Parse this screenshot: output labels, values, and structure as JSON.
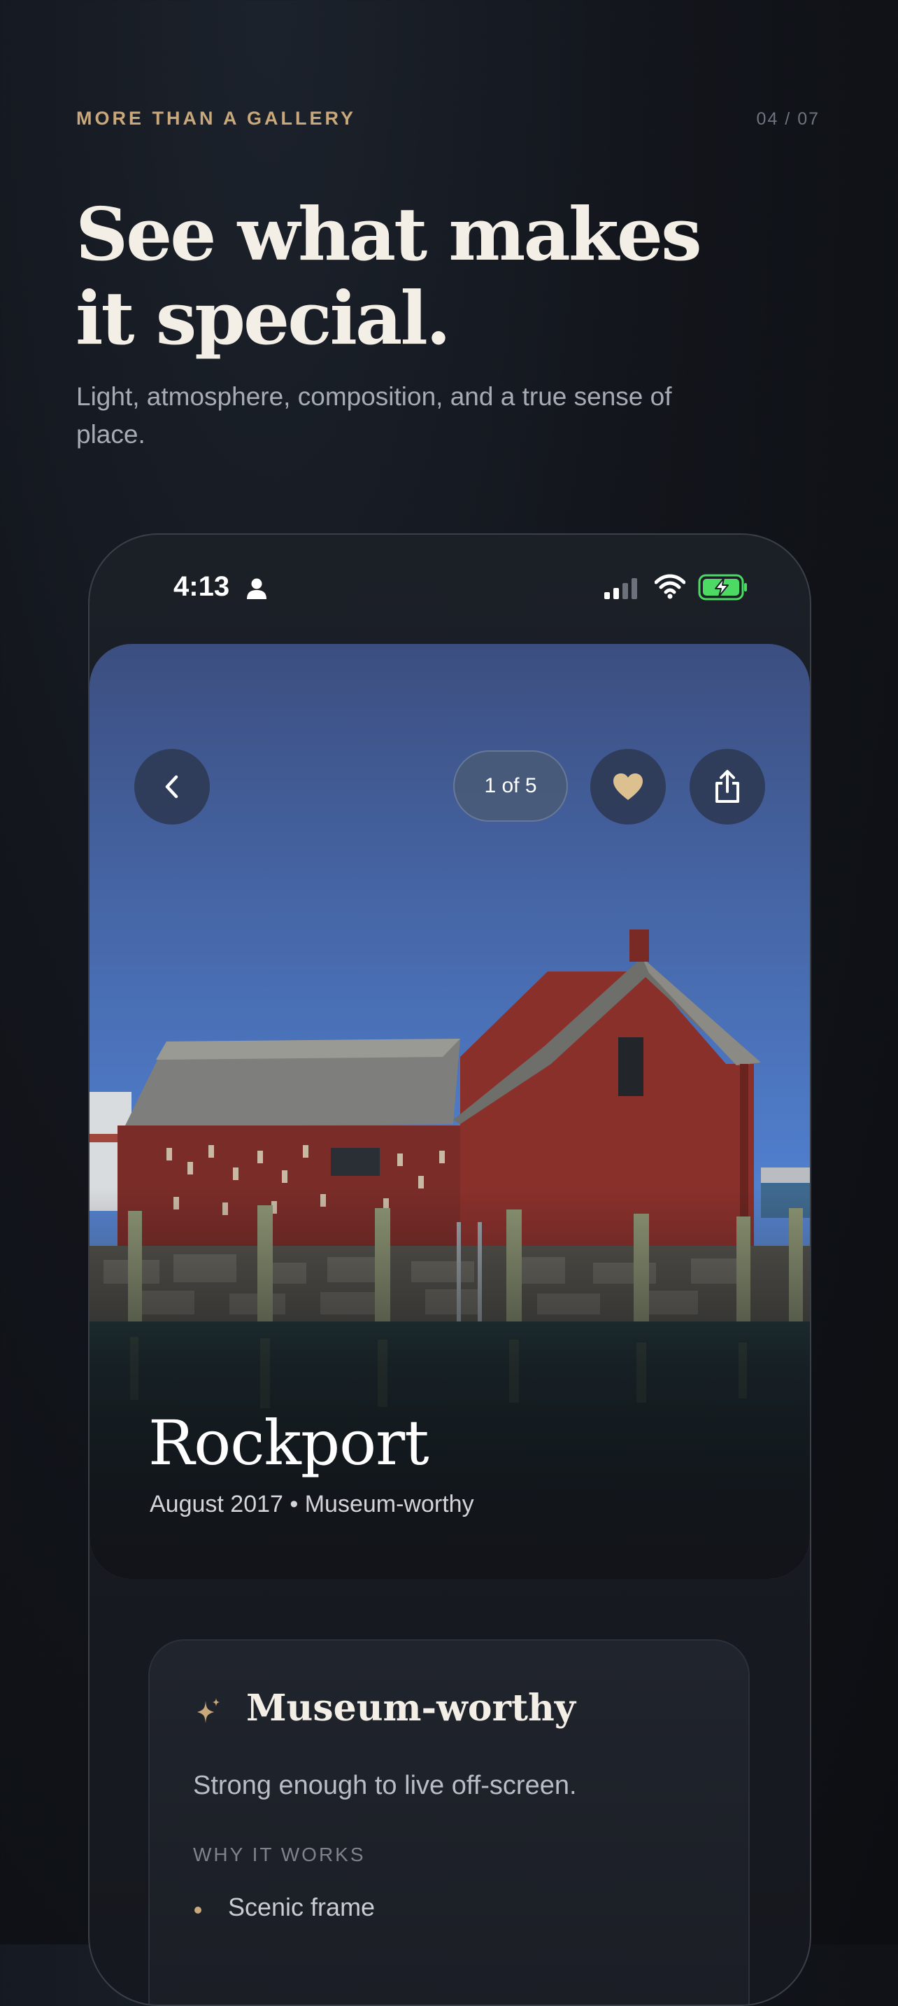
{
  "header": {
    "eyebrow": "MORE THAN A GALLERY",
    "counter": "04 / 07",
    "headline_line1": "See what makes",
    "headline_line2": "it special.",
    "subhead": "Light, atmosphere, composition, and a true sense of place."
  },
  "statusbar": {
    "time": "4:13",
    "icons": [
      "person-icon",
      "cellular-signal-icon",
      "wifi-icon",
      "battery-charging-icon"
    ]
  },
  "viewer": {
    "pager": "1 of 5",
    "buttons": [
      "back-chevron-icon",
      "heart-icon",
      "share-icon"
    ],
    "title": "Rockport",
    "meta": "August 2017 • Museum-worthy"
  },
  "card": {
    "icon": "sparkle-icon",
    "title": "Museum-worthy",
    "description": "Strong enough to live off-screen.",
    "section_label": "WHY IT WORKS",
    "reasons": [
      "Scenic frame"
    ]
  },
  "colors": {
    "accent_gold": "#c9a87b",
    "background": "#12151b",
    "battery_green": "#4cd964"
  }
}
